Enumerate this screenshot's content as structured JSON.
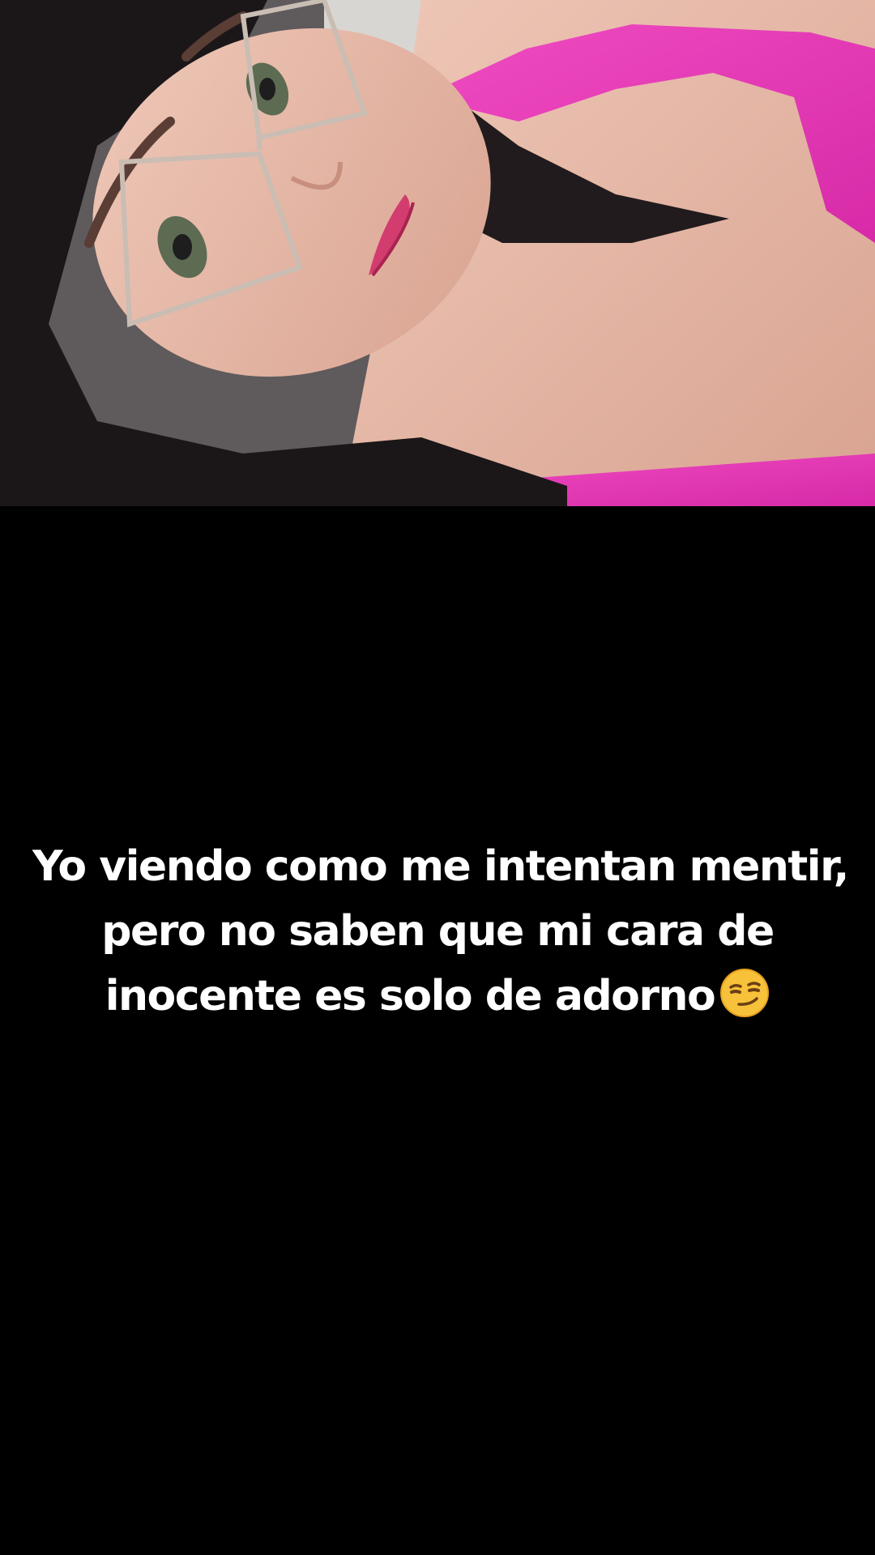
{
  "photo": {
    "alt_subject": "selfie-photo",
    "colors": {
      "shirt": "#e83db8",
      "skin": "#e8b9a6",
      "hair": "#1b1718",
      "background": "#000000"
    }
  },
  "caption": {
    "lines": [
      "Yo viendo como me intentan mentir,",
      "pero no saben que mi cara de",
      "inocente es solo de adorno"
    ],
    "emoji": "smirking-face-emoji",
    "text_color": "#ffffff"
  }
}
